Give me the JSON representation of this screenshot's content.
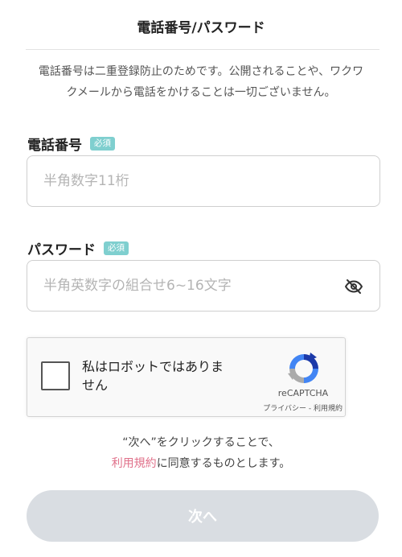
{
  "header": {
    "title": "電話番号/パスワード"
  },
  "notice": {
    "line1": "電話番号は二重登録防止のためです。公開されることや、ワクワ",
    "line2": "クメールから電話をかけることは一切ございません。"
  },
  "phone": {
    "label": "電話番号",
    "badge": "必須",
    "placeholder": "半角数字11桁",
    "value": ""
  },
  "password": {
    "label": "パスワード",
    "badge": "必須",
    "placeholder": "半角英数字の組合せ6~16文字",
    "value": "",
    "toggle_icon": "eye-off-icon"
  },
  "recaptcha": {
    "label": "私はロボットではありま せん",
    "brand": "reCAPTCHA",
    "links": "プライバシー - 利用規約",
    "checked": false
  },
  "consent": {
    "line1": "“次へ”をクリックすることで、",
    "link": "利用規約",
    "line2_rest": "に同意するものとします。"
  },
  "next_button": {
    "label": "次へ",
    "enabled": false
  },
  "colors": {
    "badge": "#7fcfcf",
    "link": "#e0708a",
    "button_disabled": "#d9dde2"
  }
}
